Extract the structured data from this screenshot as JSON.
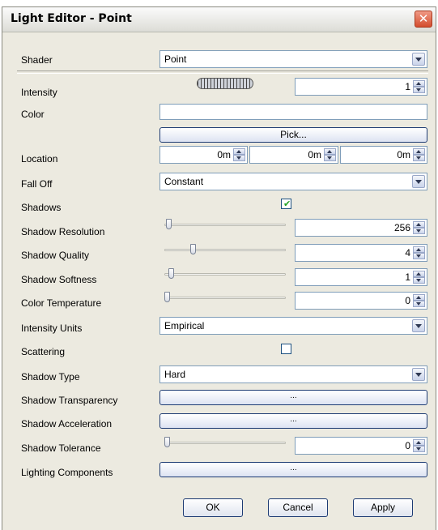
{
  "window": {
    "title": "Light Editor - Point",
    "close_glyph": "✕"
  },
  "shader": {
    "label": "Shader",
    "value": "Point"
  },
  "intensity": {
    "label": "Intensity",
    "value": "1"
  },
  "color": {
    "label": "Color",
    "pick_label": "Pick..."
  },
  "location": {
    "label": "Location",
    "x": "0m",
    "y": "0m",
    "z": "0m"
  },
  "fall_off": {
    "label": "Fall Off",
    "value": "Constant"
  },
  "shadows": {
    "label": "Shadows",
    "checked": true,
    "check_glyph": "✔"
  },
  "shadow_resolution": {
    "label": "Shadow Resolution",
    "value": "256",
    "slider_level": 0.03
  },
  "shadow_quality": {
    "label": "Shadow Quality",
    "value": "4",
    "slider_level": 0.23
  },
  "shadow_softness": {
    "label": "Shadow Softness",
    "value": "1",
    "slider_level": 0.05
  },
  "color_temperature": {
    "label": "Color Temperature",
    "value": "0",
    "slider_level": 0.02
  },
  "intensity_units": {
    "label": "Intensity Units",
    "value": "Empirical"
  },
  "scattering": {
    "label": "Scattering",
    "checked": false
  },
  "shadow_type": {
    "label": "Shadow Type",
    "value": "Hard"
  },
  "shadow_transparency": {
    "label": "Shadow Transparency",
    "button": "..."
  },
  "shadow_acceleration": {
    "label": "Shadow Acceleration",
    "button": "..."
  },
  "shadow_tolerance": {
    "label": "Shadow Tolerance",
    "value": "0",
    "slider_level": 0.02
  },
  "lighting_components": {
    "label": "Lighting Components",
    "button": "..."
  },
  "footer": {
    "ok": "OK",
    "cancel": "Cancel",
    "apply": "Apply"
  },
  "icons": {
    "close": "close-icon",
    "dropdown": "chevron-down-icon",
    "spinner": "spinner-arrows-icon",
    "jog": "jog-wheel-icon",
    "check": "checkmark-icon"
  },
  "colors": {
    "window_bg": "#eceae0",
    "close_button": "#d44d2e",
    "accent_border": "#1d3b73",
    "check": "#21a121"
  }
}
